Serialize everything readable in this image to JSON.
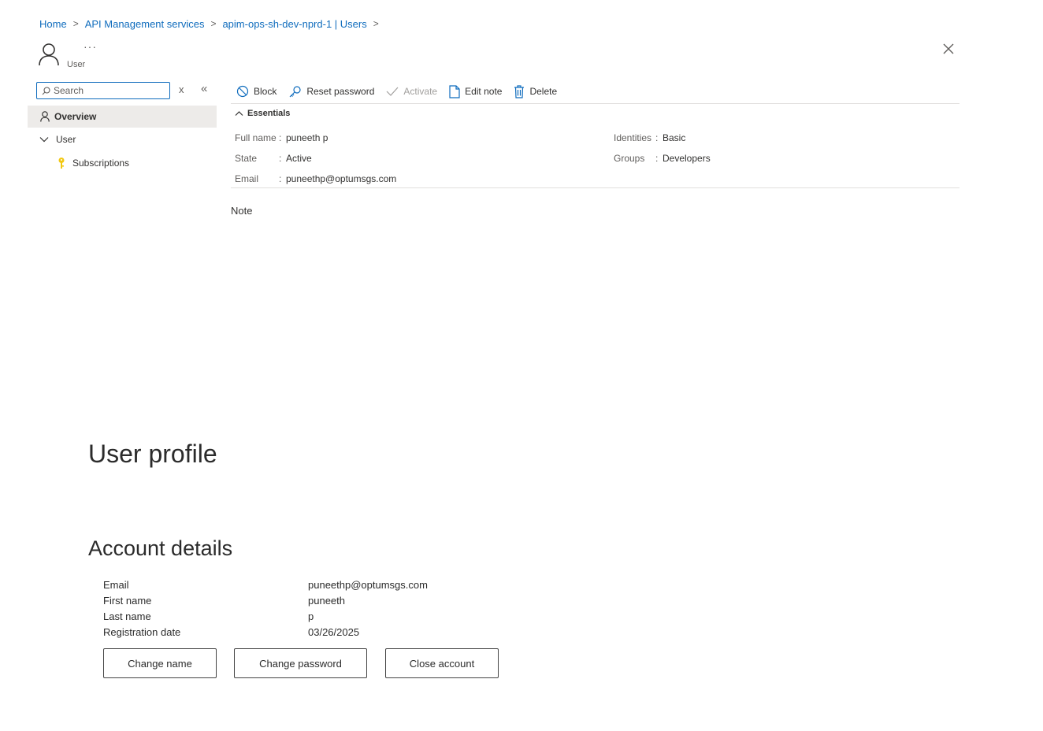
{
  "breadcrumb": {
    "items": [
      "Home",
      "API Management services",
      "apim-ops-sh-dev-nprd-1 | Users"
    ],
    "separator": ">"
  },
  "header": {
    "subtitle": "User",
    "more_label": "···",
    "close_label": "×"
  },
  "nav": {
    "search_placeholder": "Search",
    "clear_label": "x",
    "collapse_label": "«",
    "items": [
      {
        "label": "Overview",
        "icon": "person-icon",
        "selected": true
      },
      {
        "label": "User",
        "icon": "chevron-down-icon"
      },
      {
        "label": "Subscriptions",
        "icon": "key-icon"
      }
    ]
  },
  "toolbar": {
    "block": "Block",
    "reset_password": "Reset password",
    "activate": "Activate",
    "edit_note": "Edit note",
    "delete": "Delete"
  },
  "essentials": {
    "title": "Essentials",
    "left": [
      {
        "label": "Full name",
        "value": "puneeth p"
      },
      {
        "label": "State",
        "value": "Active"
      },
      {
        "label": "Email",
        "value": "puneethp@optumsgs.com"
      }
    ],
    "right": [
      {
        "label": "Identities",
        "value": "Basic"
      },
      {
        "label": "Groups",
        "value": "Developers"
      }
    ],
    "colon": ":"
  },
  "note": {
    "label": "Note"
  },
  "profile": {
    "title": "User profile",
    "account_title": "Account details",
    "rows": [
      {
        "label": "Email",
        "value": "puneethp@optumsgs.com"
      },
      {
        "label": "First name",
        "value": "puneeth"
      },
      {
        "label": "Last name",
        "value": "p"
      },
      {
        "label": "Registration date",
        "value": "03/26/2025"
      }
    ],
    "buttons": {
      "change_name": "Change name",
      "change_password": "Change password",
      "close_account": "Close account"
    }
  },
  "colors": {
    "link": "#0f6cbd",
    "selected_bg": "#edebe9",
    "key_icon": "#f2c811"
  }
}
